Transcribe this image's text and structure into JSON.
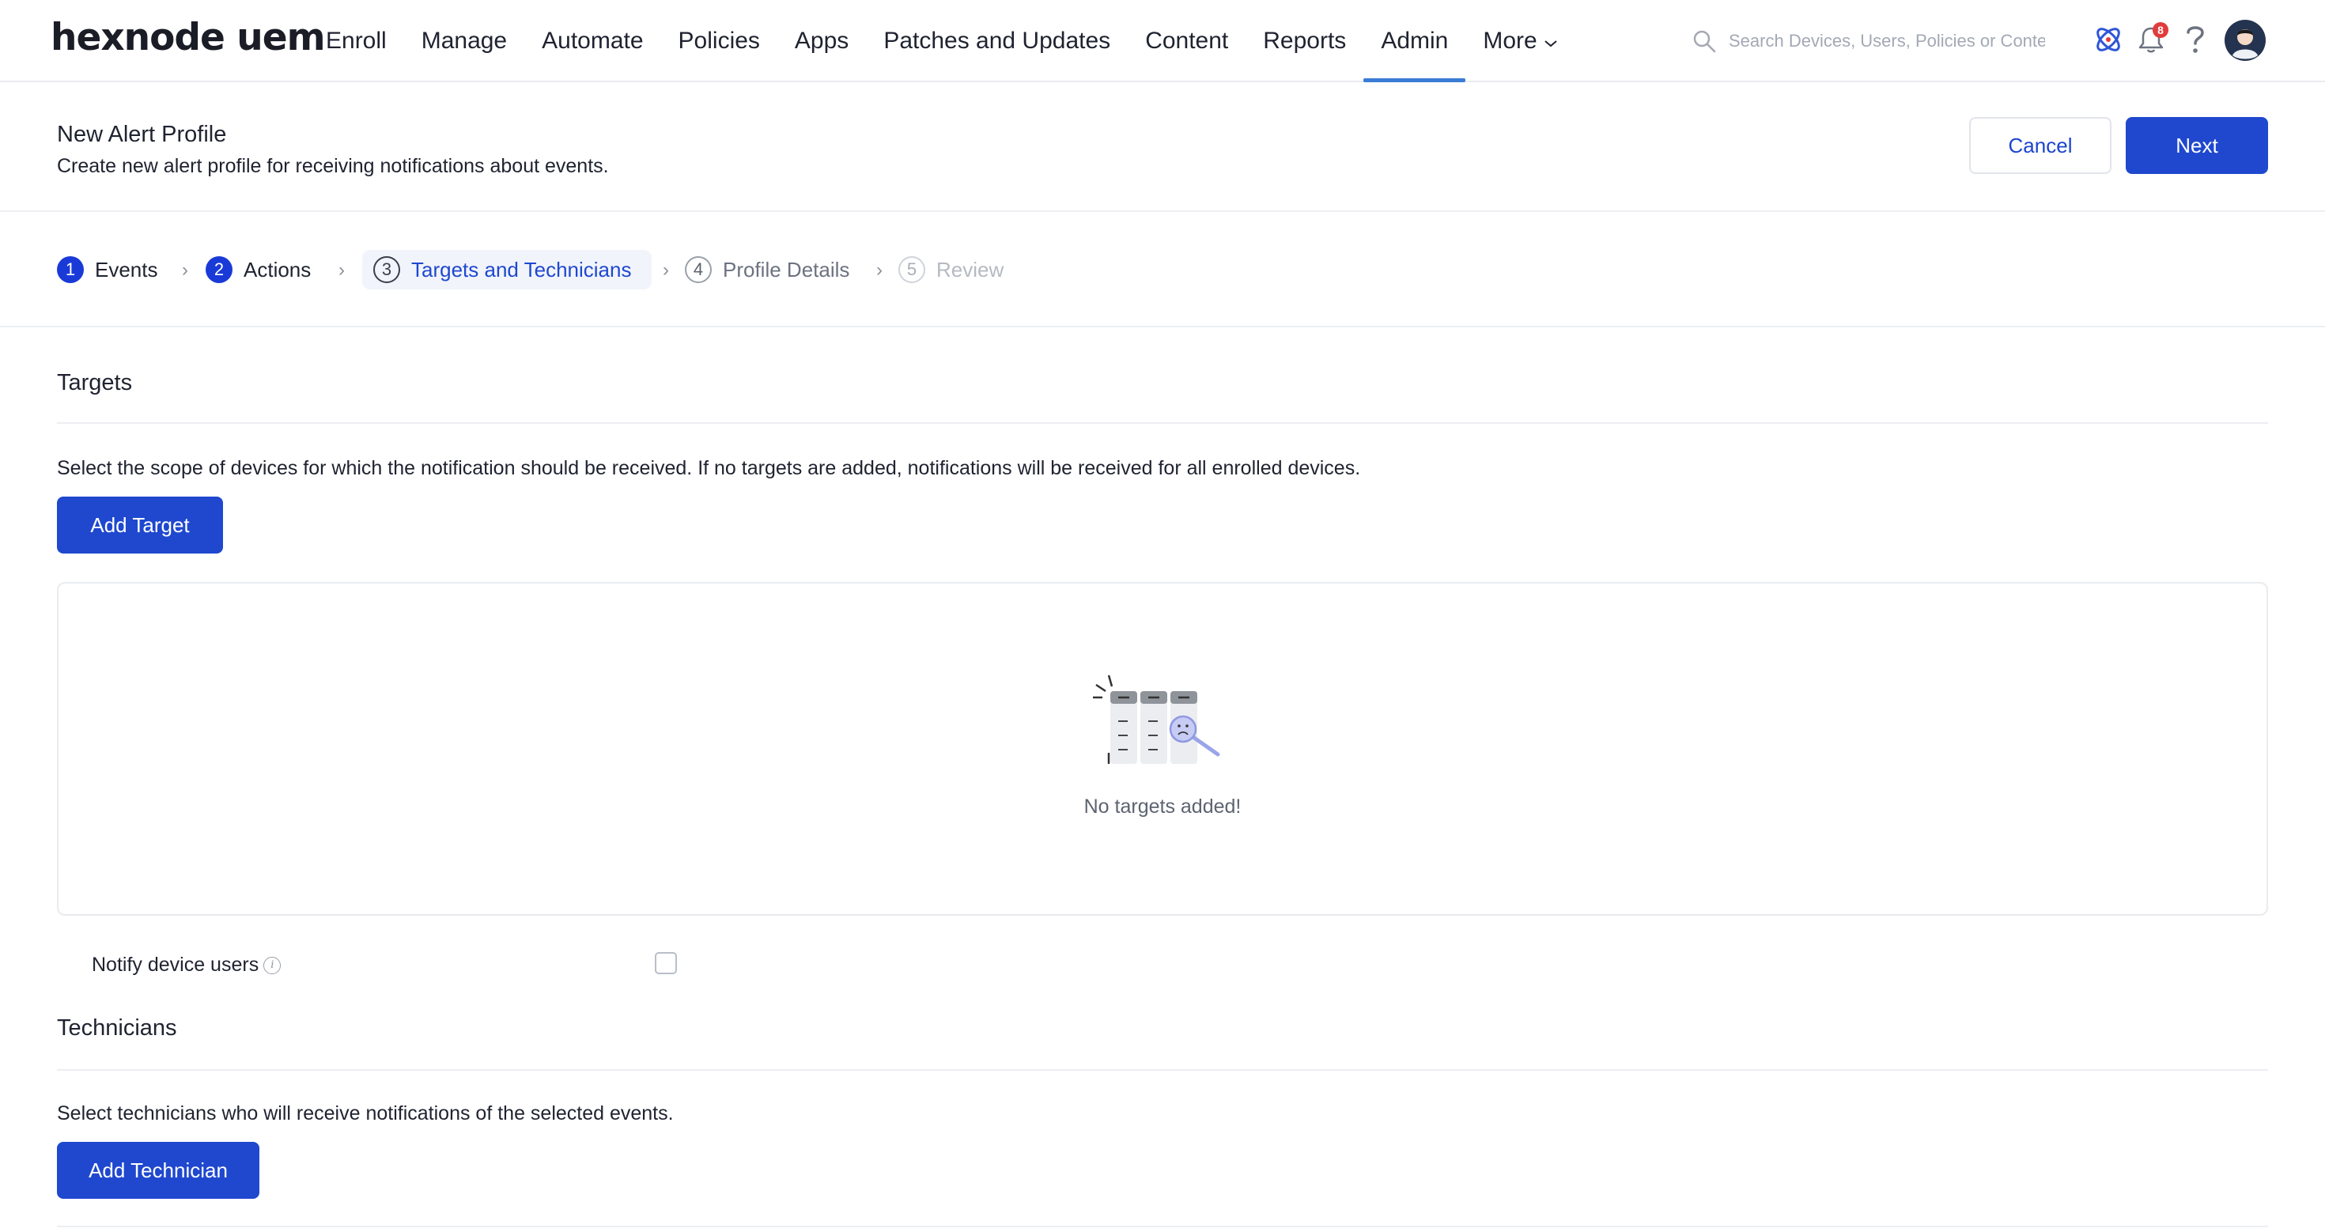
{
  "brand": {
    "logo_text": "hexnode uem"
  },
  "nav": {
    "items": [
      {
        "label": "Enroll"
      },
      {
        "label": "Manage"
      },
      {
        "label": "Automate"
      },
      {
        "label": "Policies"
      },
      {
        "label": "Apps"
      },
      {
        "label": "Patches and Updates"
      },
      {
        "label": "Content"
      },
      {
        "label": "Reports"
      },
      {
        "label": "Admin",
        "active": true
      },
      {
        "label": "More"
      }
    ]
  },
  "search": {
    "placeholder": "Search Devices, Users, Policies or Content"
  },
  "notifications": {
    "count": "8"
  },
  "header": {
    "title": "New Alert Profile",
    "subtitle": "Create new alert profile for receiving notifications about events.",
    "cancel_label": "Cancel",
    "next_label": "Next"
  },
  "steps": [
    {
      "num": "1",
      "label": "Events",
      "state": "done"
    },
    {
      "num": "2",
      "label": "Actions",
      "state": "done"
    },
    {
      "num": "3",
      "label": "Targets and Technicians",
      "state": "current"
    },
    {
      "num": "4",
      "label": "Profile Details",
      "state": "pending"
    },
    {
      "num": "5",
      "label": "Review",
      "state": "disabled"
    }
  ],
  "targets": {
    "title": "Targets",
    "description": "Select the scope of devices for which the notification should be received. If no targets are added, notifications will be received for all enrolled devices.",
    "add_label": "Add Target",
    "empty_text": "No targets added!",
    "notify_label": "Notify device users",
    "notify_checked": false
  },
  "technicians": {
    "title": "Technicians",
    "description": "Select technicians who will receive notifications of the selected events.",
    "add_label": "Add Technician"
  },
  "colors": {
    "primary": "#1f48cf",
    "nav_active": "#3a7bd5",
    "badge": "#e23b3b"
  }
}
